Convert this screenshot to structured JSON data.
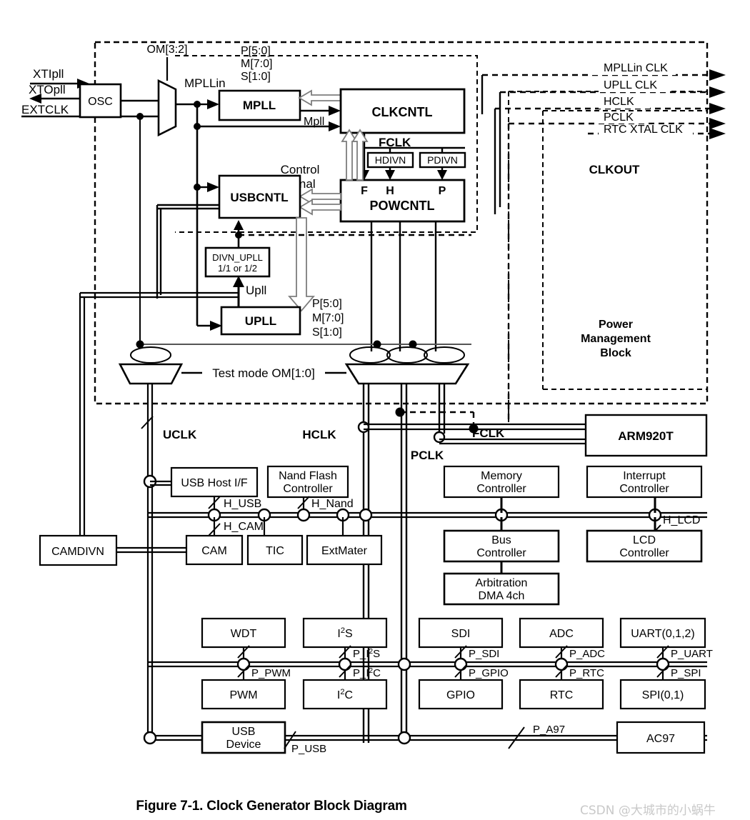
{
  "figure": {
    "caption": "Figure 7-1. Clock Generator Block Diagram",
    "watermark": "CSDN @大城市的小蜗牛"
  },
  "blocks": {
    "osc": "OSC",
    "mpll": "MPLL",
    "upll": "UPLL",
    "clkcntl": "CLKCNTL",
    "powcntl": "POWCNTL",
    "usbcntl": "USBCNTL",
    "hdivn": "HDIVN",
    "pdivn": "PDIVN",
    "divn_upll_line1": "DIVN_UPLL",
    "divn_upll_line2": "1/1 or 1/2",
    "arm": "ARM920T",
    "usb_host": "USB Host I/F",
    "nand_line1": "Nand Flash",
    "nand_line2": "Controller",
    "cam": "CAM",
    "tic": "TIC",
    "extmater": "ExtMater",
    "camdivn": "CAMDIVN",
    "memory_line1": "Memory",
    "memory_line2": "Controller",
    "interrupt_line1": "Interrupt",
    "interrupt_line2": "Controller",
    "bus_line1": "Bus",
    "bus_line2": "Controller",
    "lcd_line1": "LCD",
    "lcd_line2": "Controller",
    "arbitration_line1": "Arbitration",
    "arbitration_line2": "DMA 4ch",
    "wdt": "WDT",
    "i2s": "I",
    "i2s_sup": "2",
    "i2s_tail": "S",
    "sdi": "SDI",
    "adc": "ADC",
    "uart": "UART(0,1,2)",
    "pwm": "PWM",
    "i2c": "I",
    "i2c_sup": "2",
    "i2c_tail": "C",
    "gpio": "GPIO",
    "rtc": "RTC",
    "spi": "SPI(0,1)",
    "usb_device_line1": "USB",
    "usb_device_line2": "Device",
    "ac97": "AC97"
  },
  "labels": {
    "xtipll": "XTIpll",
    "xtopll": "XTOpll",
    "extclk": "EXTCLK",
    "om32": "OM[3:2]",
    "mpllin": "MPLLin",
    "mpll_p": "P[5:0]",
    "mpll_m": "M[7:0]",
    "mpll_s": "S[1:0]",
    "upll_p": "P[5:0]",
    "upll_m": "M[7:0]",
    "upll_s": "S[1:0]",
    "mpll_out": "Mpll",
    "upll_out": "Upll",
    "fclk_top": "FCLK",
    "control": "Control",
    "signal": "Signal",
    "f": "F",
    "h": "H",
    "p": "P",
    "clkout": "CLKOUT",
    "pmb_line1": "Power",
    "pmb_line2": "Management",
    "pmb_line3": "Block",
    "testmode": "Test mode OM[1:0]",
    "uclk": "UCLK",
    "hclk": "HCLK",
    "pclk": "PCLK",
    "fclk": "FCLK",
    "h_usb": "H_USB",
    "h_nand": "H_Nand",
    "h_cam": "H_CAM",
    "h_lcd": "H_LCD",
    "p_pwm": "P_PWM",
    "p_i2s_pre": "P_I",
    "p_i2s_sup": "2",
    "p_i2s_tail": "S",
    "p_i2c_pre": "P_I",
    "p_i2c_sup": "2",
    "p_i2c_tail": "C",
    "p_sdi": "P_SDI",
    "p_adc": "P_ADC",
    "p_uart": "P_UART",
    "p_gpio": "P_GPIO",
    "p_rtc": "P_RTC",
    "p_spi": "P_SPI",
    "p_usb": "P_USB",
    "p_a97": "P_A97"
  },
  "clock_outputs": [
    "MPLLin CLK",
    "UPLL CLK",
    "HCLK",
    "PCLK",
    "RTC XTAL CLK"
  ],
  "colors": {
    "line": "#000000",
    "fill": "#ffffff",
    "watermark": "#c9c9c9"
  }
}
